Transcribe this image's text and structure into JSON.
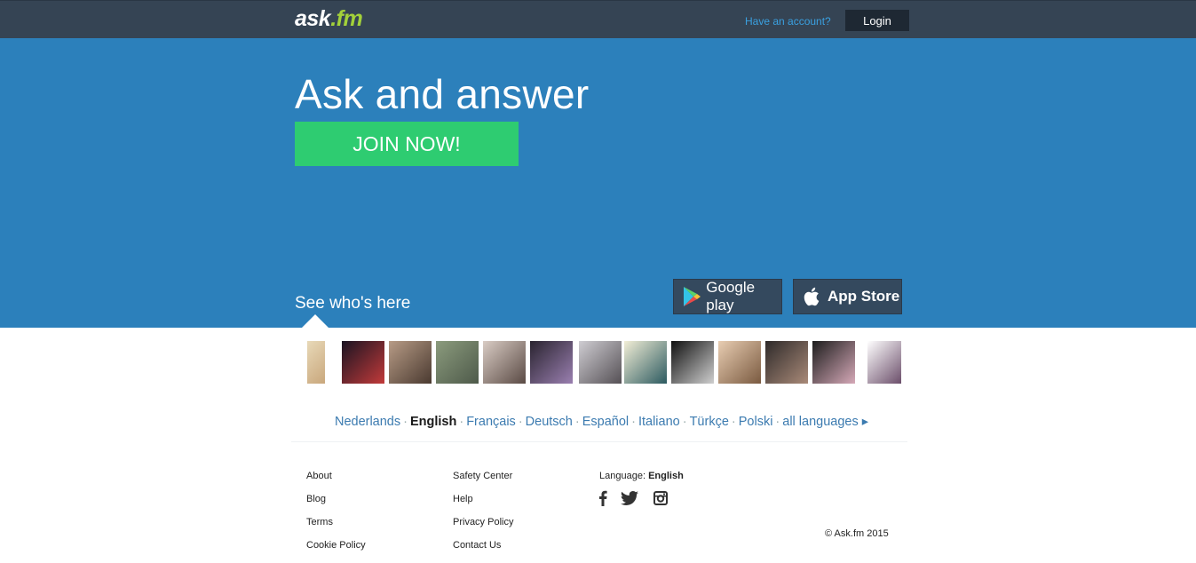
{
  "header": {
    "logo_ask": "ask",
    "logo_fm": ".fm",
    "have_account": "Have an account?",
    "login_label": "Login"
  },
  "hero": {
    "title": "Ask and answer",
    "join_label": "JOIN NOW!",
    "see_who": "See who's here",
    "google_play_label": "Google play",
    "app_store_label": "App Store"
  },
  "avatars": [
    {
      "name": "avatar-1",
      "colors": [
        "#e8d9b8",
        "#c9a77c"
      ]
    },
    {
      "name": "avatar-2",
      "colors": [
        "#1a1422",
        "#c23a3a"
      ]
    },
    {
      "name": "avatar-3",
      "colors": [
        "#b79b86",
        "#4a3a30"
      ]
    },
    {
      "name": "avatar-4",
      "colors": [
        "#8b9b7d",
        "#4e5a4a"
      ]
    },
    {
      "name": "avatar-5",
      "colors": [
        "#d9ccc4",
        "#5a4a44"
      ]
    },
    {
      "name": "avatar-6",
      "colors": [
        "#2a2430",
        "#9a7fb0"
      ]
    },
    {
      "name": "avatar-7",
      "colors": [
        "#cfcdd2",
        "#555055"
      ]
    },
    {
      "name": "avatar-8",
      "colors": [
        "#f2eed6",
        "#2c5a60"
      ]
    },
    {
      "name": "avatar-9",
      "colors": [
        "#111111",
        "#cfcfcf"
      ]
    },
    {
      "name": "avatar-10",
      "colors": [
        "#e8cdb2",
        "#7a5a40"
      ]
    },
    {
      "name": "avatar-11",
      "colors": [
        "#2e2a2a",
        "#a98a78"
      ]
    },
    {
      "name": "avatar-12",
      "colors": [
        "#1d1d1d",
        "#d6a9b8"
      ]
    },
    {
      "name": "avatar-13",
      "colors": [
        "#ffffff",
        "#6b4e6a"
      ]
    }
  ],
  "languages": {
    "items": [
      {
        "label": "Nederlands",
        "current": false
      },
      {
        "label": "English",
        "current": true
      },
      {
        "label": "Français",
        "current": false
      },
      {
        "label": "Deutsch",
        "current": false
      },
      {
        "label": "Español",
        "current": false
      },
      {
        "label": "Italiano",
        "current": false
      },
      {
        "label": "Türkçe",
        "current": false
      },
      {
        "label": "Polski",
        "current": false
      }
    ],
    "all_label": "all languages ▸"
  },
  "footer": {
    "col1": [
      "About",
      "Blog",
      "Terms",
      "Cookie Policy"
    ],
    "col2": [
      "Safety Center",
      "Help",
      "Privacy Policy",
      "Contact Us"
    ],
    "language_label": "Language:",
    "language_value": "English",
    "copyright": "© Ask.fm 2015",
    "social": [
      "facebook-icon",
      "twitter-icon",
      "instagram-icon"
    ]
  },
  "colors": {
    "topbar": "#354454",
    "hero": "#2c80bb",
    "join": "#2ecc71",
    "logo_fm": "#a3d13a",
    "link": "#3c7bb0"
  }
}
